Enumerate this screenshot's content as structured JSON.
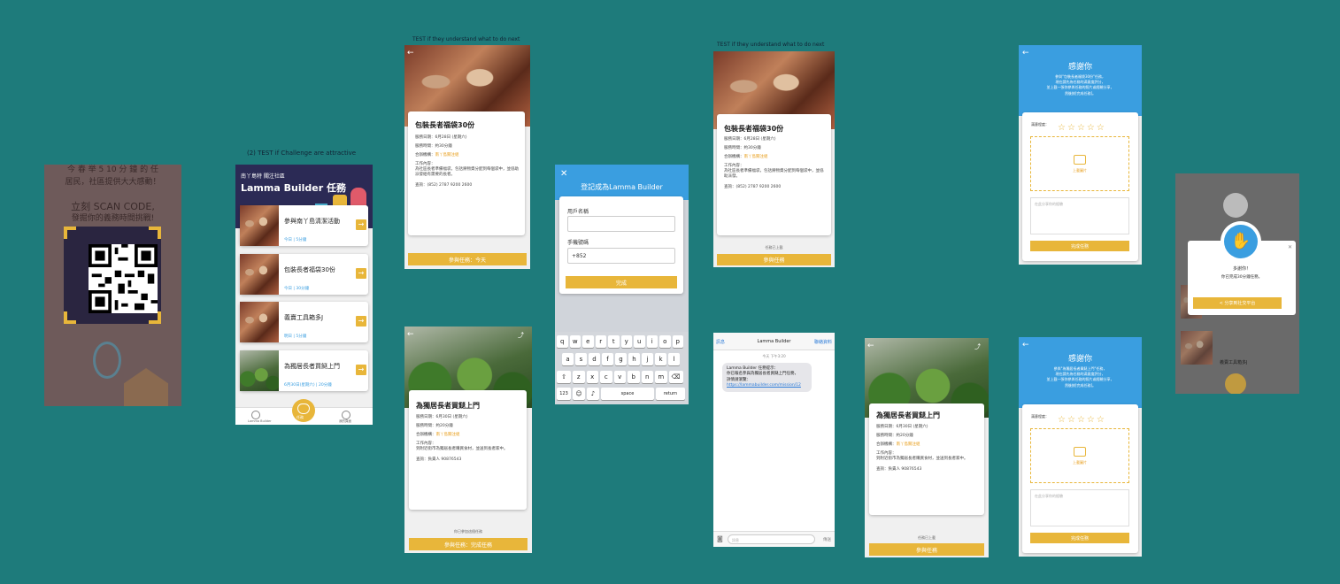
{
  "captions": {
    "c1": "(2) TEST if Challenge are attractive",
    "c2": "TEST if they understand what to do next",
    "c3": "TEST if they understand what to do next"
  },
  "poster": {
    "line1": "今 春 举 5 10 分 鐘 的 任",
    "line2": "居民，社區提供大大感動！",
    "line3": "立刻 SCAN CODE,",
    "line4": "發掘你的義務時間挑戰!"
  },
  "home": {
    "brand": "南丫島特 關注社區",
    "title": "Lamma Builder 任務",
    "items": [
      {
        "title": "參與南丫島清潔活動",
        "meta1": "今日",
        "meta2": "5分鐘"
      },
      {
        "title": "包裝長者福袋30份",
        "meta1": "今日",
        "meta2": "30分鐘"
      },
      {
        "title": "義賣工具箱多J",
        "meta1": "明日",
        "meta2": "5分鐘"
      },
      {
        "title": "為獨居長者買餸上門",
        "meta1": "6月30日(星期六)",
        "meta2": "20分鐘"
      }
    ],
    "tabs": [
      "Lamma Builder",
      "任務",
      "我的頁面"
    ]
  },
  "detail1": {
    "title": "包裝長者福袋30份",
    "date": "服務日期：6月28日 (星期六)",
    "time": "服務時間：約30分鐘",
    "org_label": "合辦機構：",
    "org": "南丫島關注組",
    "work_label": "工作內容：",
    "work": "為社區長者準備福袋，包括將物資分配到每個袋中，並協助派發給有需要的長者。",
    "contact": "查詢：(852) 2787 9200 2600",
    "btn": "參與任務：今天"
  },
  "register": {
    "title": "登記成為Lamma Builder",
    "name_label": "用戶名稱",
    "phone_label": "手機號碼",
    "phone_value": "+852",
    "submit": "完成",
    "keys_row1": [
      "q",
      "w",
      "e",
      "r",
      "t",
      "y",
      "u",
      "i",
      "o",
      "p"
    ],
    "keys_row2": [
      "a",
      "s",
      "d",
      "f",
      "g",
      "h",
      "j",
      "k",
      "l"
    ],
    "keys_row3": [
      "z",
      "x",
      "c",
      "v",
      "b",
      "n",
      "m"
    ],
    "key_123": "123",
    "key_space": "space",
    "key_return": "return"
  },
  "detail2": {
    "title": "包裝長者福袋30份",
    "date": "服務日期：6月28日 (星期六)",
    "time": "服務時間：約30分鐘",
    "org_label": "合辦機構：",
    "org": "南丫島關注組",
    "work_label": "工作內容：",
    "work": "為社區長者準備福袋，包括將物資分配到每個袋中，並協助派發。",
    "contact": "查詢：(852) 2787 9200 2600",
    "note": "任務已上載",
    "btn": "參與任務"
  },
  "detail3": {
    "title": "為獨居長者買餸上門",
    "date": "服務日期：6月30日 (星期六)",
    "time": "服務時間：約20分鐘",
    "org_label": "合辦機構：",
    "org": "南丫島關注組",
    "work_label": "工作內容：",
    "work": "到附近街市為獨居長者購買食材，並送到長者家中。",
    "contact": "查詢：負責人 90876543",
    "note": "你已參加這個任務",
    "btn": "參與任務：完成任務"
  },
  "sms": {
    "back": "訊息",
    "contact": "Lamma Builder",
    "action": "聯絡資料",
    "time": "今天 下午3:20",
    "bubble1": "Lamma Builder 任務提示：",
    "bubble2": "你已報名參與為獨居長者買餸上門任務，",
    "bubble3": "詳情請瀏覽：",
    "link": "https://lammabuilder.com/mission/12",
    "input_placeholder": "訊息",
    "send": "傳送"
  },
  "detail4": {
    "title": "為獨居長者買餸上門",
    "date": "服務日期：6月30日 (星期六)",
    "time": "服務時間：約20分鐘",
    "org_label": "合辦機構：",
    "org": "南丫島關注組",
    "work_label": "工作內容：",
    "work": "到附近街市為獨居長者購買食材，並送到長者家中。",
    "contact": "查詢：負責人 90876543",
    "note": "任務已上載",
    "btn": "參與任務"
  },
  "thanks1": {
    "title": "感謝你",
    "line1": "參與\"包裝長者福袋30份\"任務，",
    "line2": "現在請先為任務的滿意度評分，",
    "line3": "並上載一張你參與任務的照片或經驗分享，",
    "line4": "然後按[完成任務]。",
    "rating_label": "滿意程度：",
    "upload": "上載圖片",
    "share_placeholder": "在此分享你的經驗",
    "btn": "完成任務"
  },
  "thanks2": {
    "title": "感謝你",
    "line1": "參與\"為獨居長者買餸上門\"任務，",
    "line2": "現在請先為任務的滿意度評分，",
    "line3": "並上載一張你參與任務的照片或經驗分享，",
    "line4": "然後按[完成任務]。",
    "rating_label": "滿意程度：",
    "upload": "上載圖片",
    "share_placeholder": "在此分享你的經驗",
    "btn": "完成任務"
  },
  "final": {
    "msg1": "多謝你！",
    "msg2": "你已完成30分鐘任務。",
    "share_btn": "分享到社交平台",
    "bg_item": "義賣工具箱多J"
  },
  "colors": {
    "accent": "#e8b63a",
    "blue": "#3a9ee0",
    "bg": "#1e7b7b"
  }
}
